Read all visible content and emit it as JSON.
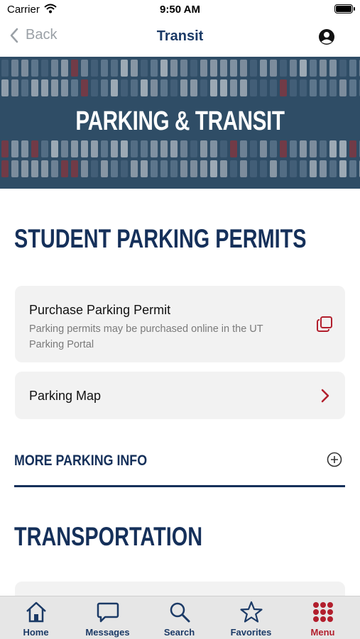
{
  "status_bar": {
    "carrier": "Carrier",
    "time": "9:50 AM"
  },
  "nav": {
    "back_label": "Back",
    "title": "Transit"
  },
  "hero": {
    "title": "PARKING & TRANSIT"
  },
  "sections": {
    "student_parking": "STUDENT PARKING PERMITS",
    "transportation": "TRANSPORTATION"
  },
  "cards": [
    {
      "title": "Purchase Parking Permit",
      "description": "Parking permits may be purchased online in the UT Parking Portal",
      "icon": "external-copy-icon"
    },
    {
      "title": "Parking Map",
      "icon": "chevron-right-icon"
    }
  ],
  "more_info": {
    "label": "MORE PARKING INFO",
    "icon": "plus-circle-icon"
  },
  "tabs": [
    {
      "label": "Home",
      "icon": "home-icon"
    },
    {
      "label": "Messages",
      "icon": "message-icon"
    },
    {
      "label": "Search",
      "icon": "search-icon"
    },
    {
      "label": "Favorites",
      "icon": "star-icon"
    },
    {
      "label": "Menu",
      "icon": "grid-icon",
      "active": true
    }
  ],
  "colors": {
    "navy": "#15305a",
    "accent_red": "#b21f2d",
    "card_bg": "#f2f2f2",
    "tab_bg": "#e6e6e6"
  }
}
